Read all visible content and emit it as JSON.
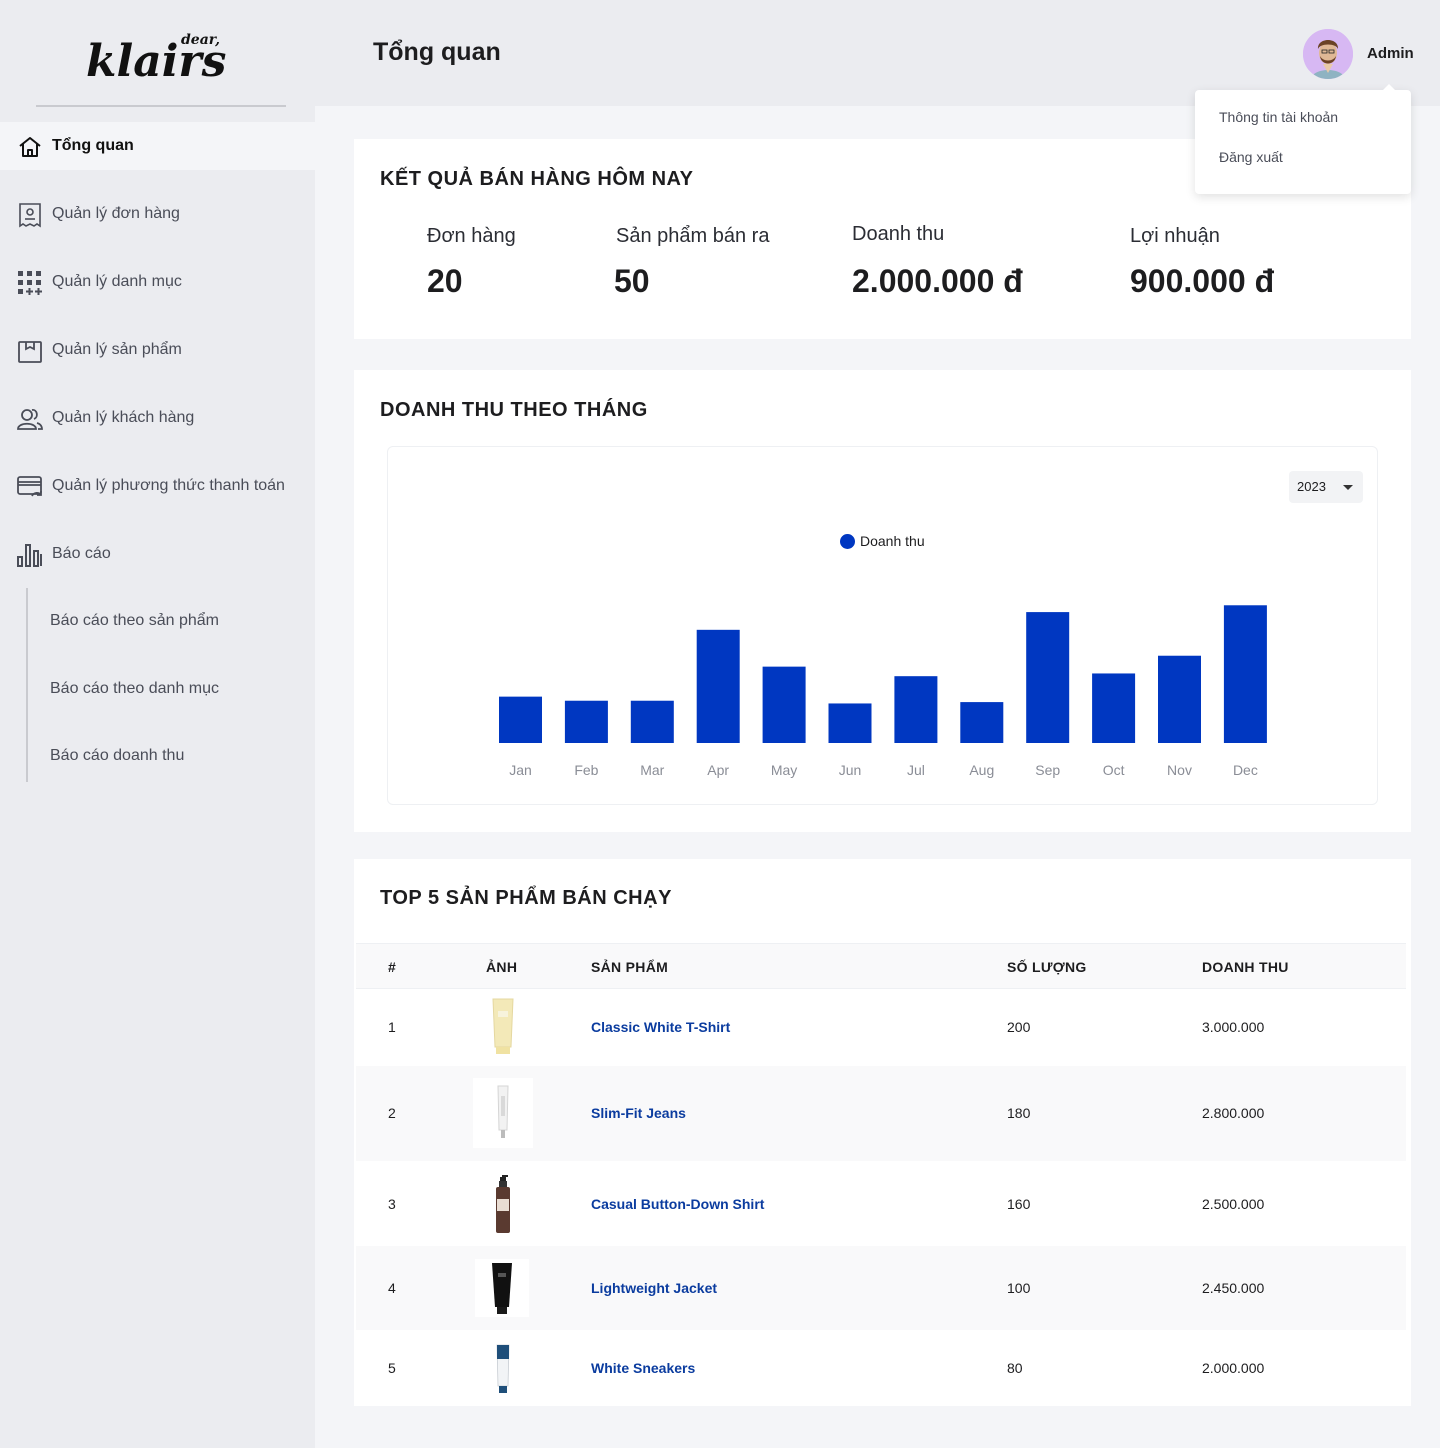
{
  "brand": {
    "logo_main": "klairs",
    "logo_small": "dear,"
  },
  "sidebar": {
    "items": [
      {
        "label": "Tổng quan",
        "icon": "home-icon"
      },
      {
        "label": "Quản lý đơn hàng",
        "icon": "receipt-icon"
      },
      {
        "label": "Quản lý danh mục",
        "icon": "grid-icon"
      },
      {
        "label": "Quản lý sản phẩm",
        "icon": "box-icon"
      },
      {
        "label": "Quản lý khách hàng",
        "icon": "users-icon"
      },
      {
        "label": "Quản lý phương thức thanh toán",
        "icon": "card-icon"
      },
      {
        "label": "Báo cáo",
        "icon": "bar-chart-icon"
      }
    ],
    "sub_items": [
      {
        "label": "Báo cáo theo sản phẩm"
      },
      {
        "label": "Báo cáo theo danh mục"
      },
      {
        "label": "Báo cáo doanh thu"
      }
    ]
  },
  "header": {
    "title": "Tổng quan",
    "user_name": "Admin",
    "dropdown": [
      "Thông tin tài khoản",
      "Đăng xuất"
    ]
  },
  "today": {
    "title": "KẾT QUẢ BÁN HÀNG HÔM NAY",
    "stats": [
      {
        "label": "Đơn hàng",
        "value": "20"
      },
      {
        "label": "Sản phẩm bán ra",
        "value": "50"
      },
      {
        "label": "Doanh thu",
        "value": "2.000.000 đ"
      },
      {
        "label": "Lợi nhuận",
        "value": "900.000 đ"
      }
    ]
  },
  "monthly": {
    "title": "DOANH THU THEO THÁNG",
    "year": "2023"
  },
  "chart_data": {
    "type": "bar",
    "categories": [
      "Jan",
      "Feb",
      "Mar",
      "Apr",
      "May",
      "Jun",
      "Jul",
      "Aug",
      "Sep",
      "Oct",
      "Nov",
      "Dec"
    ],
    "series": [
      {
        "name": "Doanh thu",
        "values": [
          34,
          31,
          31,
          83,
          56,
          29,
          49,
          30,
          96,
          51,
          64,
          101
        ]
      }
    ],
    "ylim": [
      0,
      110
    ],
    "legend": "top-center",
    "grid": false,
    "colors": {
      "bar": "#0037c1",
      "tick": "#8a8d96"
    }
  },
  "top5": {
    "title": "TOP 5 SẢN PHẨM BÁN CHẠY",
    "columns": [
      "#",
      "ẢNH",
      "SẢN PHẨM",
      "SỐ LƯỢNG",
      "DOANH THU"
    ],
    "rows": [
      {
        "rank": "1",
        "product": "Classic White T-Shirt",
        "qty": "200",
        "revenue": "3.000.000",
        "thumb": "yellow-tube"
      },
      {
        "rank": "2",
        "product": "Slim-Fit Jeans",
        "qty": "180",
        "revenue": "2.800.000",
        "thumb": "white-tube"
      },
      {
        "rank": "3",
        "product": "Casual Button-Down Shirt",
        "qty": "160",
        "revenue": "2.500.000",
        "thumb": "brown-pump-bottle"
      },
      {
        "rank": "4",
        "product": "Lightweight Jacket",
        "qty": "100",
        "revenue": "2.450.000",
        "thumb": "black-tube"
      },
      {
        "rank": "5",
        "product": "White Sneakers",
        "qty": "80",
        "revenue": "2.000.000",
        "thumb": "blue-white-tube"
      }
    ]
  },
  "colors": {
    "accent": "#0037c1",
    "link": "#0b3c9f",
    "sidebar_bg": "#ebecf0"
  }
}
